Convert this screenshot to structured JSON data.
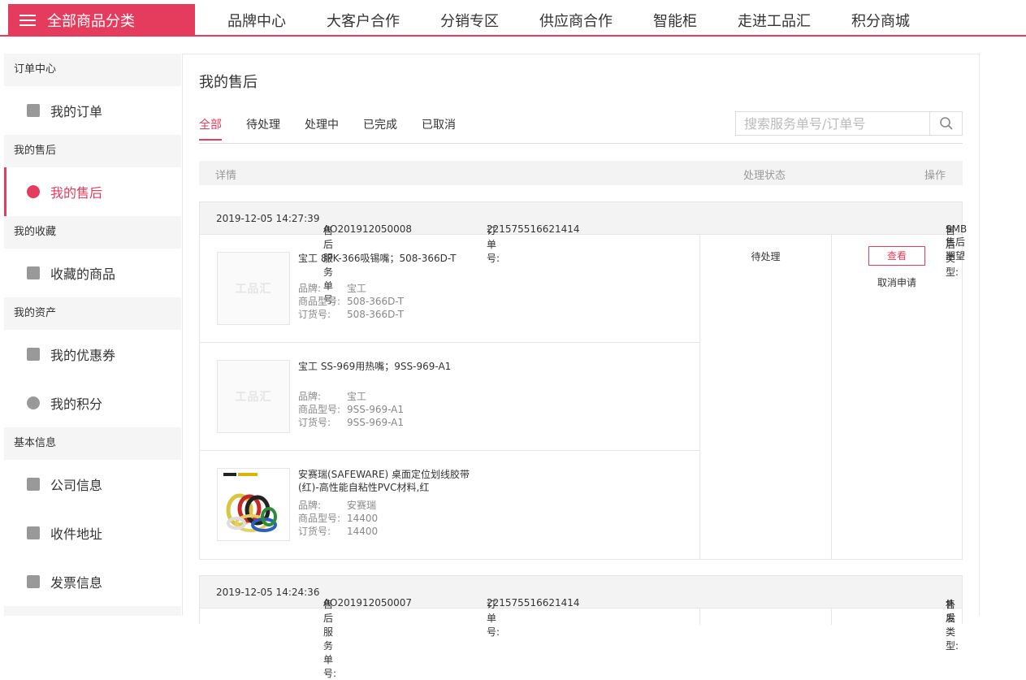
{
  "topnav": {
    "category_label": "全部商品分类",
    "items": [
      "品牌中心",
      "大客户合作",
      "分销专区",
      "供应商合作",
      "智能柜",
      "走进工品汇",
      "积分商城"
    ]
  },
  "sidebar": {
    "groups": [
      {
        "title": "订单中心",
        "items": [
          {
            "label": "我的订单",
            "icon": "order-icon"
          }
        ]
      },
      {
        "title": "我的售后",
        "items": [
          {
            "label": "我的售后",
            "icon": "aftersale-icon"
          }
        ]
      },
      {
        "title": "我的收藏",
        "items": [
          {
            "label": "收藏的商品",
            "icon": "heart-icon"
          }
        ]
      },
      {
        "title": "我的资产",
        "items": [
          {
            "label": "我的优惠券",
            "icon": "coupon-icon"
          },
          {
            "label": "我的积分",
            "icon": "coins-icon"
          }
        ]
      },
      {
        "title": "基本信息",
        "items": [
          {
            "label": "公司信息",
            "icon": "company-card-icon"
          },
          {
            "label": "收件地址",
            "icon": "truck-icon"
          },
          {
            "label": "发票信息",
            "icon": "invoice-icon"
          }
        ]
      }
    ]
  },
  "page": {
    "title": "我的售后",
    "tabs": [
      "全部",
      "待处理",
      "处理中",
      "已完成",
      "已取消"
    ],
    "active_tab": "全部",
    "search_placeholder": "搜索服务单号/订单号",
    "table_headers": {
      "detail": "详情",
      "status": "处理状态",
      "action": "操作"
    }
  },
  "labels": {
    "brand": "品牌:",
    "model": "商品型号:",
    "order_code": "订货号:",
    "service_no": "售后服务单号:",
    "order_no": "订单号:",
    "type": "售后类型:",
    "view": "查看",
    "cancel": "取消申请",
    "placeholder_logo": "工品汇"
  },
  "orders": [
    {
      "datetime": "2019-12-05 14:27:39",
      "service_no": "AO201912050008",
      "order_no": "221575516621414",
      "type": "SMB售后期望",
      "status": "待处理",
      "items": [
        {
          "name": "宝工 8PK-366吸锡嘴；508-366D-T",
          "brand": "宝工",
          "model": "508-366D-T",
          "code": "508-366D-T"
        },
        {
          "name": "宝工 SS-969用热嘴；9SS-969-A1",
          "brand": "宝工",
          "model": "9SS-969-A1",
          "code": "9SS-969-A1"
        },
        {
          "name": "安赛瑞(SAFEWARE) 桌面定位划线胶带(红)-高性能自粘性PVC材料,红",
          "brand": "安赛瑞",
          "model": "14400",
          "code": "14400"
        }
      ]
    },
    {
      "datetime": "2019-12-05 14:24:36",
      "service_no": "AO201912050007",
      "order_no": "221575516621414",
      "type": "补发"
    }
  ],
  "colors": {
    "accent": "#e53c5d"
  }
}
